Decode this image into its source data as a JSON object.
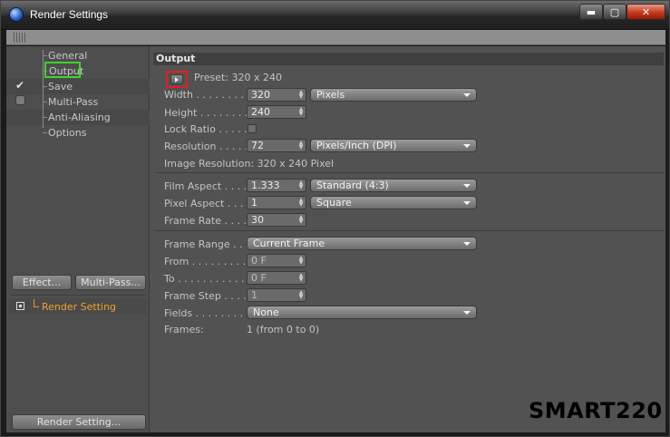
{
  "window": {
    "title": "Render Settings",
    "controls": {
      "minimize": "▬",
      "maximize": "▢",
      "close": "✕"
    }
  },
  "sidebar": {
    "items": [
      {
        "label": "General"
      },
      {
        "label": "Output"
      },
      {
        "label": "Save"
      },
      {
        "label": "Multi-Pass"
      },
      {
        "label": "Anti-Aliasing"
      },
      {
        "label": "Options"
      }
    ],
    "buttons": {
      "effect": "Effect...",
      "multipass": "Multi-Pass..."
    },
    "render_setting_item": "Render Setting",
    "render_setting_button": "Render Setting..."
  },
  "output": {
    "section_title": "Output",
    "preset": "Preset: 320 x 240",
    "width": {
      "label": "Width . . . . . . . . . .",
      "value": "320",
      "unit": "Pixels"
    },
    "height": {
      "label": "Height  . . . . . . . .",
      "value": "240"
    },
    "lock_ratio": {
      "label": "Lock Ratio . . . . . ."
    },
    "resolution": {
      "label": "Resolution  . . . . . .",
      "value": "72",
      "unit": "Pixels/Inch (DPI)"
    },
    "image_resolution": "Image Resolution: 320 x 240 Pixel",
    "film_aspect": {
      "label": "Film Aspect . . . . . .",
      "value": "1.333",
      "option": "Standard (4:3)"
    },
    "pixel_aspect": {
      "label": "Pixel Aspect . . . . .",
      "value": "1",
      "option": "Square"
    },
    "frame_rate": {
      "label": "Frame Rate  . . . . .",
      "value": "30"
    },
    "frame_range": {
      "label": "Frame Range . . . .",
      "option": "Current Frame"
    },
    "from": {
      "label": "From . . . . . . . . . . .",
      "value": "0 F"
    },
    "to": {
      "label": "To  . . . . . . . . . . . .",
      "value": "0 F"
    },
    "frame_step": {
      "label": "Frame Step . . . . . .",
      "value": "1"
    },
    "fields": {
      "label": "Fields  . . . . . . . . . .",
      "option": "None"
    },
    "frames": {
      "label": "Frames:",
      "value": "1 (from 0 to 0)"
    }
  },
  "watermark": "SMART220",
  "colors": {
    "accent_orange": "#f0a030",
    "highlight_green": "#3cd62a",
    "highlight_red": "#e22020",
    "panel": "#525252"
  }
}
